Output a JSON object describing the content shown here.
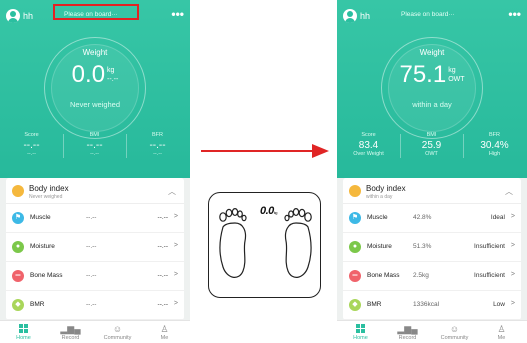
{
  "left_phone": {
    "user_name": "hh",
    "board_status": "Please on board···",
    "weight_label": "Weight",
    "weight_value": "0.0",
    "weight_unit": "kg",
    "weight_unit_sub": "--.--",
    "weight_sub": "Never weighed",
    "stats": [
      {
        "label": "Score",
        "value": "--.--",
        "desc": "--.--"
      },
      {
        "label": "BMI",
        "value": "--.--",
        "desc": "--.--"
      },
      {
        "label": "BFR",
        "value": "--.--",
        "desc": "--.--"
      }
    ],
    "card": {
      "title": "Body index",
      "subtitle": "Never weighed",
      "rows": [
        {
          "name": "Muscle",
          "value": "--.--",
          "status": "--.--"
        },
        {
          "name": "Moisture",
          "value": "--.--",
          "status": "--.--"
        },
        {
          "name": "Bone Mass",
          "value": "--.--",
          "status": "--.--"
        },
        {
          "name": "BMR",
          "value": "--.--",
          "status": "--.--"
        }
      ]
    },
    "tabs": [
      "Home",
      "Record",
      "Community",
      "Me"
    ]
  },
  "right_phone": {
    "user_name": "hh",
    "board_status": "Please on board···",
    "weight_label": "Weight",
    "weight_value": "75.1",
    "weight_unit": "kg",
    "weight_unit_sub": "OWT",
    "weight_sub": "within a day",
    "stats": [
      {
        "label": "Score",
        "value": "83.4",
        "desc": "Over Weight"
      },
      {
        "label": "BMI",
        "value": "25.9",
        "desc": "OWT"
      },
      {
        "label": "BFR",
        "value": "30.4%",
        "desc": "High"
      }
    ],
    "card": {
      "title": "Body index",
      "subtitle": "within a day",
      "rows": [
        {
          "name": "Muscle",
          "value": "42.8%",
          "status": "Ideal"
        },
        {
          "name": "Moisture",
          "value": "51.3%",
          "status": "Insufficient"
        },
        {
          "name": "Bone Mass",
          "value": "2.5kg",
          "status": "Insufficient"
        },
        {
          "name": "BMR",
          "value": "1336kcal",
          "status": "Low"
        }
      ]
    },
    "tabs": [
      "Home",
      "Record",
      "Community",
      "Me"
    ]
  },
  "scale_display": {
    "value": "0.0",
    "unit": "kg"
  },
  "colors": {
    "accent": "#2bbfa0",
    "highlight": "#e32222",
    "arrow": "#e02525"
  },
  "icons": {
    "more": "more-dots-icon",
    "row_icons": [
      "muscle-icon",
      "moisture-icon",
      "bone-icon",
      "bmr-icon"
    ],
    "tabs": [
      "home-grid-icon",
      "record-chart-icon",
      "community-smile-icon",
      "me-person-icon"
    ]
  }
}
